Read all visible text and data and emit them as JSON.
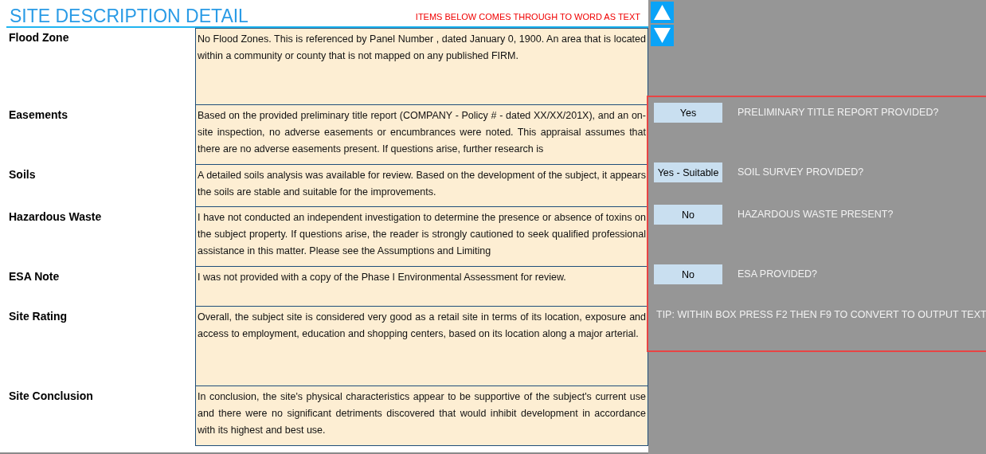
{
  "title": "SITE DESCRIPTION DETAIL",
  "notice": "ITEMS BELOW COMES THROUGH TO WORD AS TEXT",
  "rows": [
    {
      "label": "Flood Zone",
      "text": "No Flood Zones. This is referenced by Panel Number , dated January 0, 1900. An area that is located within a community or county that is not mapped on any published FIRM."
    },
    {
      "label": "Easements",
      "text": "Based on the provided preliminary title report (COMPANY - Policy # - dated XX/XX/201X), and an on-site inspection, no adverse easements or encumbrances were noted. This appraisal assumes that there are no adverse easements present. If questions arise, further research is"
    },
    {
      "label": "Soils",
      "text": "A detailed soils analysis was available for review. Based on the development of the subject, it appears the soils are stable and suitable for the improvements."
    },
    {
      "label": "Hazardous Waste",
      "text": "I have not conducted an independent investigation to determine the presence or absence of toxins on the subject property. If questions arise, the reader is strongly cautioned to seek qualified professional assistance in this matter. Please see the Assumptions and Limiting"
    },
    {
      "label": "ESA Note",
      "text": "I was not provided with a copy of the Phase I Environmental Assessment for review."
    },
    {
      "label": "Site Rating",
      "text": "Overall, the subject site is considered very good as a retail site in terms of its location, exposure and access to employment, education and shopping centers, based on its location along a major arterial."
    },
    {
      "label": "Site Conclusion",
      "text": "In conclusion, the site's physical characteristics appear to be supportive of the subject's current use and there were no significant detriments discovered that would inhibit development in accordance with its highest and best use."
    }
  ],
  "questions": [
    {
      "answer": "Yes",
      "question": "PRELIMINARY TITLE REPORT PROVIDED?"
    },
    {
      "answer": "Yes - Suitable",
      "question": "SOIL SURVEY PROVIDED?"
    },
    {
      "answer": "No",
      "question": "HAZARDOUS WASTE PRESENT?"
    },
    {
      "answer": "No",
      "question": "ESA PROVIDED?"
    }
  ],
  "tip": "TIP: WITHIN BOX PRESS F2 THEN F9 TO CONVERT TO OUTPUT TEXT"
}
